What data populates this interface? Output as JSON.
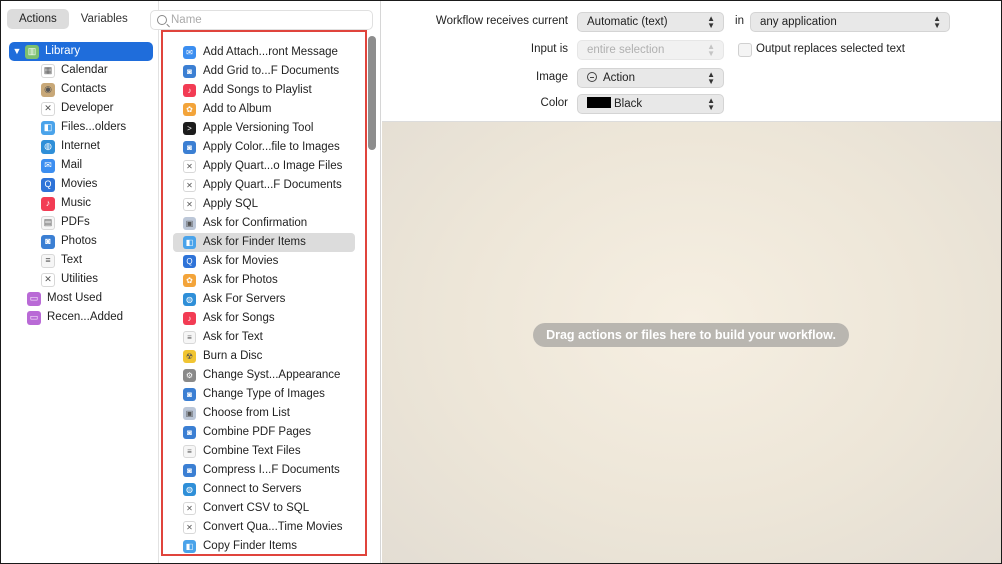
{
  "tabs": {
    "actions": "Actions",
    "variables": "Variables"
  },
  "search": {
    "placeholder": "Name"
  },
  "library": {
    "root": "Library",
    "children": [
      {
        "label": "Calendar",
        "icon": "calendar-icon",
        "color": "#ffffff"
      },
      {
        "label": "Contacts",
        "icon": "contacts-icon",
        "color": "#c8a878"
      },
      {
        "label": "Developer",
        "icon": "developer-icon",
        "color": "#ffffff"
      },
      {
        "label": "Files...olders",
        "icon": "finder-icon",
        "color": "#4aa3ea"
      },
      {
        "label": "Internet",
        "icon": "globe-icon",
        "color": "#2f8fd8"
      },
      {
        "label": "Mail",
        "icon": "mail-icon",
        "color": "#3c8ef0"
      },
      {
        "label": "Movies",
        "icon": "quicktime-icon",
        "color": "#2e73d8"
      },
      {
        "label": "Music",
        "icon": "music-icon",
        "color": "#f23c54"
      },
      {
        "label": "PDFs",
        "icon": "pdf-icon",
        "color": "#f6f6f6"
      },
      {
        "label": "Photos",
        "icon": "preview-icon",
        "color": "#3b7fd3"
      },
      {
        "label": "Text",
        "icon": "text-icon",
        "color": "#f6f6f6"
      },
      {
        "label": "Utilities",
        "icon": "utilities-icon",
        "color": "#ffffff"
      }
    ],
    "smart": [
      {
        "label": "Most Used",
        "icon": "smart-folder-icon",
        "color": "#b96ad6"
      },
      {
        "label": "Recen...Added",
        "icon": "smart-folder-icon",
        "color": "#b96ad6"
      }
    ]
  },
  "actions": [
    {
      "label": "Add Attach...ront Message",
      "icon": "mail-icon",
      "color": "#3c8ef0"
    },
    {
      "label": "Add Grid to...F Documents",
      "icon": "preview-icon",
      "color": "#3b7fd3"
    },
    {
      "label": "Add Songs to Playlist",
      "icon": "music-icon",
      "color": "#f23c54"
    },
    {
      "label": "Add to Album",
      "icon": "photos-icon",
      "color": "#f3a43a"
    },
    {
      "label": "Apple Versioning Tool",
      "icon": "terminal-icon",
      "color": "#1c1c1c"
    },
    {
      "label": "Apply Color...file to Images",
      "icon": "preview-icon",
      "color": "#3b7fd3"
    },
    {
      "label": "Apply Quart...o Image Files",
      "icon": "tools-icon",
      "color": "#ffffff"
    },
    {
      "label": "Apply Quart...F Documents",
      "icon": "tools-icon",
      "color": "#ffffff"
    },
    {
      "label": "Apply SQL",
      "icon": "tools-icon",
      "color": "#ffffff"
    },
    {
      "label": "Ask for Confirmation",
      "icon": "automator-icon",
      "color": "#bcc7d8"
    },
    {
      "label": "Ask for Finder Items",
      "icon": "finder-icon",
      "color": "#4aa3ea"
    },
    {
      "label": "Ask for Movies",
      "icon": "quicktime-icon",
      "color": "#2e73d8"
    },
    {
      "label": "Ask for Photos",
      "icon": "photos-icon",
      "color": "#f3a43a"
    },
    {
      "label": "Ask For Servers",
      "icon": "globe-icon",
      "color": "#2f8fd8"
    },
    {
      "label": "Ask for Songs",
      "icon": "music-icon",
      "color": "#f23c54"
    },
    {
      "label": "Ask for Text",
      "icon": "text-icon",
      "color": "#f6f6f6"
    },
    {
      "label": "Burn a Disc",
      "icon": "burn-icon",
      "color": "#f1c533"
    },
    {
      "label": "Change Syst...Appearance",
      "icon": "settings-icon",
      "color": "#8a8a8a"
    },
    {
      "label": "Change Type of Images",
      "icon": "preview-icon",
      "color": "#3b7fd3"
    },
    {
      "label": "Choose from List",
      "icon": "automator-icon",
      "color": "#bcc7d8"
    },
    {
      "label": "Combine PDF Pages",
      "icon": "preview-icon",
      "color": "#3b7fd3"
    },
    {
      "label": "Combine Text Files",
      "icon": "text-icon",
      "color": "#f6f6f6"
    },
    {
      "label": "Compress I...F Documents",
      "icon": "preview-icon",
      "color": "#3b7fd3"
    },
    {
      "label": "Connect to Servers",
      "icon": "globe-icon",
      "color": "#2f8fd8"
    },
    {
      "label": "Convert CSV to SQL",
      "icon": "tools-icon",
      "color": "#ffffff"
    },
    {
      "label": "Convert Qua...Time Movies",
      "icon": "tools-icon",
      "color": "#ffffff"
    },
    {
      "label": "Copy Finder Items",
      "icon": "finder-icon",
      "color": "#4aa3ea"
    }
  ],
  "selected_action": "Ask for Finder Items",
  "options": {
    "receives_label": "Workflow receives current",
    "receives_value": "Automatic (text)",
    "in_label": "in",
    "app_value": "any application",
    "input_label": "Input is",
    "input_value": "entire selection",
    "replace_label": "Output replaces selected text",
    "image_label": "Image",
    "image_value": "Action",
    "color_label": "Color",
    "color_value": "Black"
  },
  "canvas": {
    "message": "Drag actions or files here to build your workflow."
  },
  "colors": {
    "accent": "#1f6ddb",
    "highlight_box": "#e0443c"
  }
}
